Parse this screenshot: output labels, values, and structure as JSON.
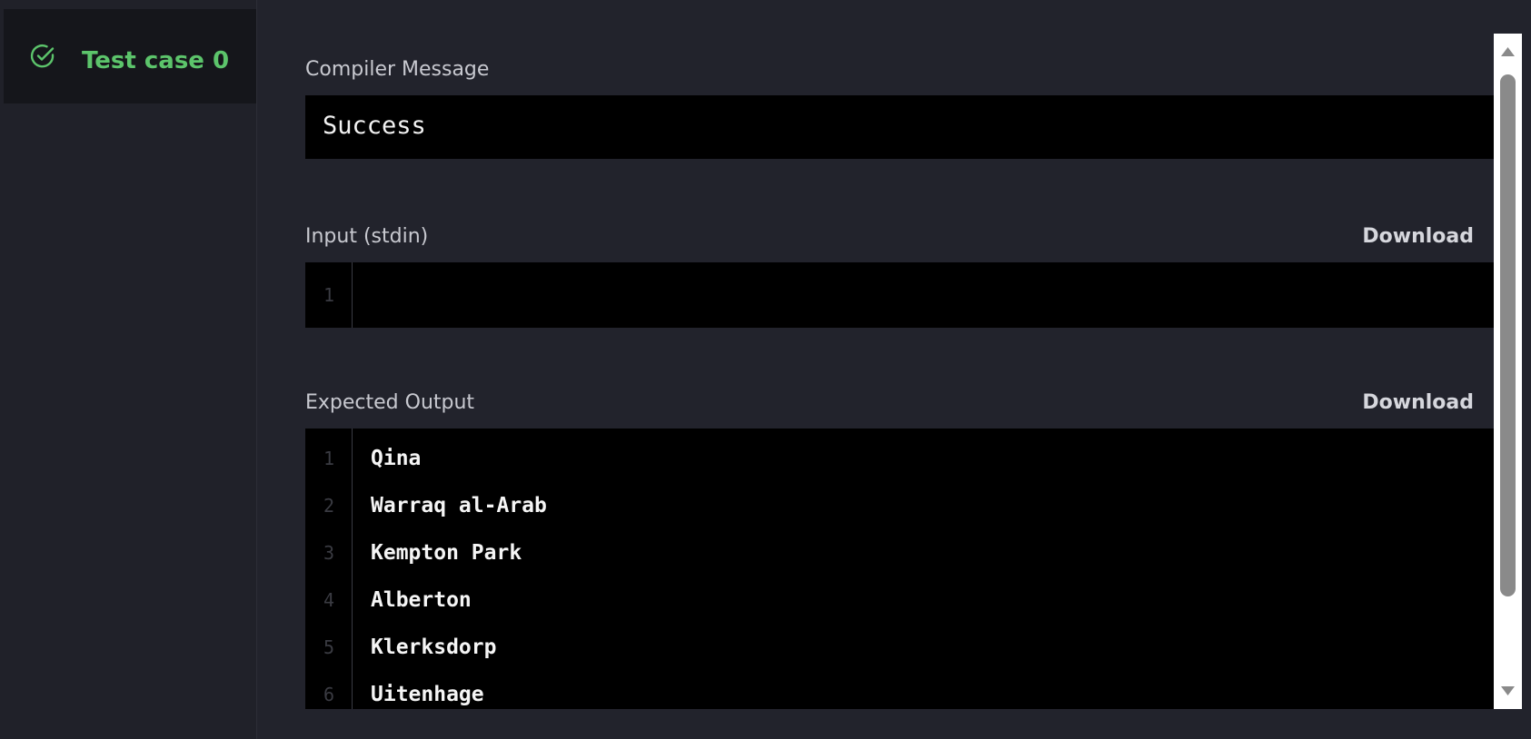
{
  "sidebar": {
    "test_case": {
      "label": "Test case 0",
      "status": "passed",
      "icon": "check-circle-icon",
      "color": "#5cc46b"
    }
  },
  "compiler": {
    "label": "Compiler Message",
    "message": "Success"
  },
  "input": {
    "label": "Input (stdin)",
    "download_label": "Download",
    "lines": [
      {
        "num": "1",
        "text": ""
      }
    ]
  },
  "expected": {
    "label": "Expected Output",
    "download_label": "Download",
    "lines": [
      {
        "num": "1",
        "text": "Qina"
      },
      {
        "num": "2",
        "text": "Warraq al-Arab"
      },
      {
        "num": "3",
        "text": "Kempton Park"
      },
      {
        "num": "4",
        "text": "Alberton"
      },
      {
        "num": "5",
        "text": "Klerksdorp"
      },
      {
        "num": "6",
        "text": "Uitenhage"
      }
    ]
  },
  "scrollbar": {
    "up_icon": "triangle-up-icon",
    "down_icon": "triangle-down-icon"
  }
}
